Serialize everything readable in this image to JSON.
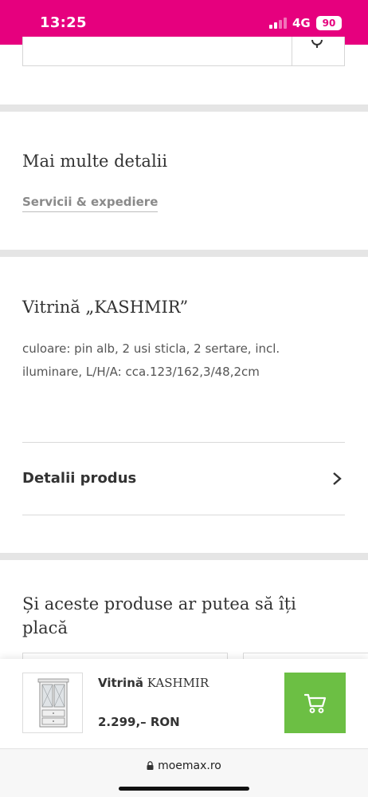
{
  "status_bar": {
    "time": "13:25",
    "network": "4G",
    "battery": "90",
    "color": "#e6007e"
  },
  "details_section": {
    "title": "Mai multe detalii",
    "tab_label": "Servicii & expediere"
  },
  "product": {
    "title": "Vitrină „KASHMIR”",
    "description": "culoare: pin alb, 2 usi sticla, 2 sertare, incl. iluminare, L/H/A: cca.123/162,3/48,2cm"
  },
  "product_details_link": {
    "label": "Detalii produs",
    "icon": "chevron-right-icon"
  },
  "recommendations": {
    "title": "Și aceste produse ar putea să îți placă"
  },
  "sticky_bar": {
    "name_prefix": "Vitrină",
    "name_suffix": "KASHMIR",
    "price": "2.299,– RON",
    "cart_icon": "cart-icon",
    "cart_color": "#6cbf44"
  },
  "browser": {
    "url": "moemax.ro",
    "lock_icon": "lock-icon"
  }
}
